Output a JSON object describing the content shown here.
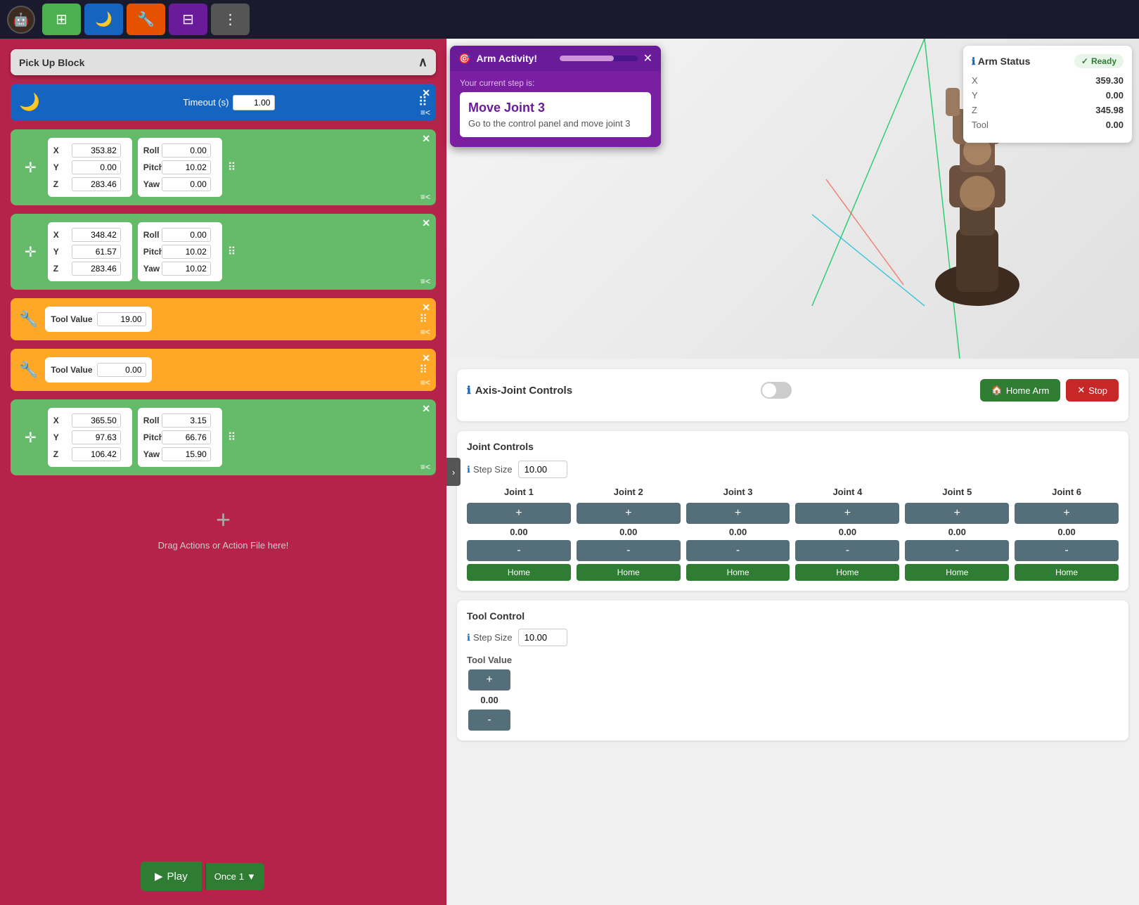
{
  "app": {
    "avatar_icon": "🤖"
  },
  "toolbar": {
    "buttons": [
      {
        "id": "grid-btn",
        "icon": "⊞",
        "color": "green",
        "label": "Grid"
      },
      {
        "id": "night-btn",
        "icon": "🌙",
        "color": "blue-dark",
        "label": "Night"
      },
      {
        "id": "settings-btn",
        "icon": "🔧",
        "color": "orange",
        "label": "Settings"
      },
      {
        "id": "layout-btn",
        "icon": "⊟",
        "color": "purple",
        "label": "Layout"
      },
      {
        "id": "more-btn",
        "icon": "⋮",
        "color": "gray",
        "label": "More"
      }
    ]
  },
  "action_panel": {
    "title": "Pick Up Block",
    "blocks": [
      {
        "type": "sleep",
        "timeout_label": "Timeout (s)",
        "timeout_value": "1.00"
      },
      {
        "type": "move",
        "x": "353.82",
        "y": "0.00",
        "z": "283.46",
        "roll": "0.00",
        "pitch": "10.02",
        "yaw": "0.00"
      },
      {
        "type": "move",
        "x": "348.42",
        "y": "61.57",
        "z": "283.46",
        "roll": "0.00",
        "pitch": "10.02",
        "yaw": "10.02"
      },
      {
        "type": "tool",
        "tool_label": "Tool Value",
        "tool_value": "19.00"
      },
      {
        "type": "tool",
        "tool_label": "Tool Value",
        "tool_value": "0.00"
      },
      {
        "type": "move",
        "x": "365.50",
        "y": "97.63",
        "z": "106.42",
        "roll": "3.15",
        "pitch": "66.76",
        "yaw": "15.90"
      }
    ],
    "drag_prompt": "Drag Actions or Action File here!",
    "play_label": "Play",
    "once_label": "Once",
    "once_value": "1"
  },
  "arm_activity": {
    "title": "Arm Activity!",
    "close_icon": "✕",
    "step_label": "Your current step is:",
    "current_step_title": "Move Joint 3",
    "current_step_desc": "Go to the control panel and move joint 3"
  },
  "arm_status": {
    "title": "Arm Status",
    "status_label": "Ready",
    "check_icon": "✓",
    "fields": [
      {
        "label": "X",
        "value": "359.30"
      },
      {
        "label": "Y",
        "value": "0.00"
      },
      {
        "label": "Z",
        "value": "345.98"
      },
      {
        "label": "Tool",
        "value": "0.00"
      }
    ]
  },
  "axis_controls": {
    "title": "Axis-Joint Controls",
    "toggle_on": false,
    "home_arm_label": "Home Arm",
    "stop_label": "Stop",
    "home_icon": "🏠",
    "stop_icon": "✕"
  },
  "joint_controls": {
    "title": "Joint Controls",
    "step_size_label": "Step Size",
    "step_size_value": "10.00",
    "joints": [
      {
        "label": "Joint 1",
        "plus": "+",
        "value": "0.00",
        "minus": "-",
        "home": "Home"
      },
      {
        "label": "Joint 2",
        "plus": "+",
        "value": "0.00",
        "minus": "-",
        "home": "Home"
      },
      {
        "label": "Joint 3",
        "plus": "+",
        "value": "0.00",
        "minus": "-",
        "home": "Home"
      },
      {
        "label": "Joint 4",
        "plus": "+",
        "value": "0.00",
        "minus": "-",
        "home": "Home"
      },
      {
        "label": "Joint 5",
        "plus": "+",
        "value": "0.00",
        "minus": "-",
        "home": "Home"
      },
      {
        "label": "Joint 6",
        "plus": "+",
        "value": "0.00",
        "minus": "-",
        "home": "Home"
      }
    ]
  },
  "tool_control": {
    "title": "Tool Control",
    "step_size_label": "Step Size",
    "step_size_value": "10.00",
    "tool_value_label": "Tool Value",
    "plus": "+",
    "value": "0.00",
    "minus": "-"
  }
}
